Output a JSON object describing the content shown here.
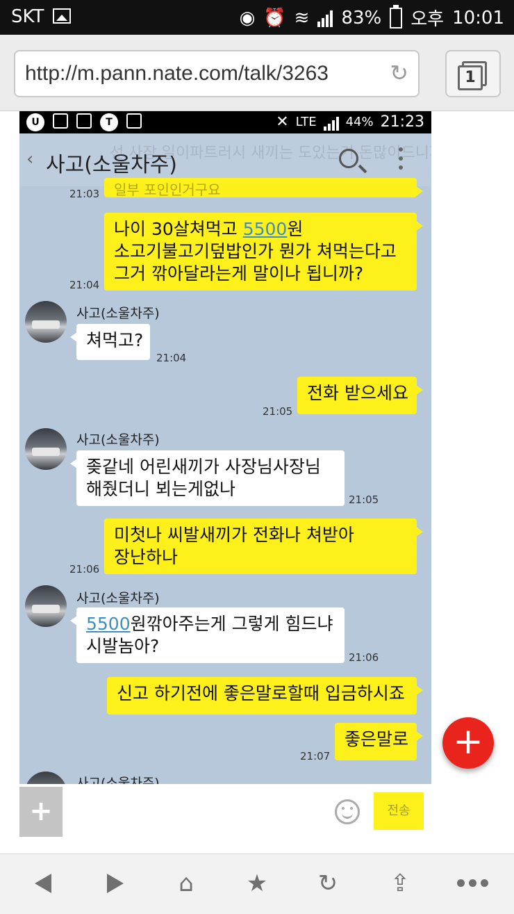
{
  "status_bar": {
    "carrier": "SKT",
    "battery": "83%",
    "ampm": "오후",
    "time": "10:01"
  },
  "browser": {
    "url": "http://m.pann.nate.com/talk/3263",
    "tab_count": "1"
  },
  "inner_status": {
    "battery": "44%",
    "time": "21:23",
    "lte": "LTE"
  },
  "chat": {
    "title": "사고(소울차주)",
    "ghost_text": "선 사장 일이파트러시 새끼는   도있는거 돈많이드니까",
    "partial_top_text": "일부 포인인거구요",
    "messages": [
      {
        "from": "me",
        "time": "21:03"
      },
      {
        "from": "me",
        "lines": [
          "나이 30살쳐먹고 ",
          "5500",
          "원",
          "소고기불고기덮밥인가 뭔가 쳐먹는다고",
          "그거 깎아달라는게 말이나 됩니까?"
        ],
        "time": "21:04"
      },
      {
        "from": "other",
        "sender": "사고(소울차주)",
        "text": "쳐먹고?",
        "time": "21:04"
      },
      {
        "from": "me",
        "text": "전화 받으세요",
        "time": "21:05"
      },
      {
        "from": "other",
        "sender": "사고(소울차주)",
        "lines": [
          "좆같네 어린새끼가 사장님사장님",
          "해줬더니 뵈는게없나"
        ],
        "time": "21:05"
      },
      {
        "from": "me",
        "lines": [
          "미첫나 씨발새끼가 전화나 쳐받아",
          "장난하나"
        ],
        "time": "21:06"
      },
      {
        "from": "other",
        "sender": "사고(소울차주)",
        "lines": [
          "5500",
          "원깎아주는게 그렇게 힘드냐",
          "시발놈아?"
        ],
        "time": "21:06"
      },
      {
        "from": "me",
        "text": "신고 하기전에 좋은말로할때 입금하시죠",
        "time": ""
      },
      {
        "from": "me",
        "text": "좋은말로",
        "time": "21:07"
      },
      {
        "from": "other",
        "sender": "사고(소울차주)"
      }
    ],
    "send_label": "전송"
  },
  "bottom_nav": {
    "items": [
      "back-icon",
      "forward-icon",
      "home-icon",
      "star-icon",
      "refresh-icon",
      "share-icon",
      "more-icon"
    ]
  },
  "colors": {
    "my_bubble": "#fef01b",
    "chat_bg": "#b6c8d9",
    "fab": "#e8241c",
    "link_number": "#3e8fbf"
  }
}
